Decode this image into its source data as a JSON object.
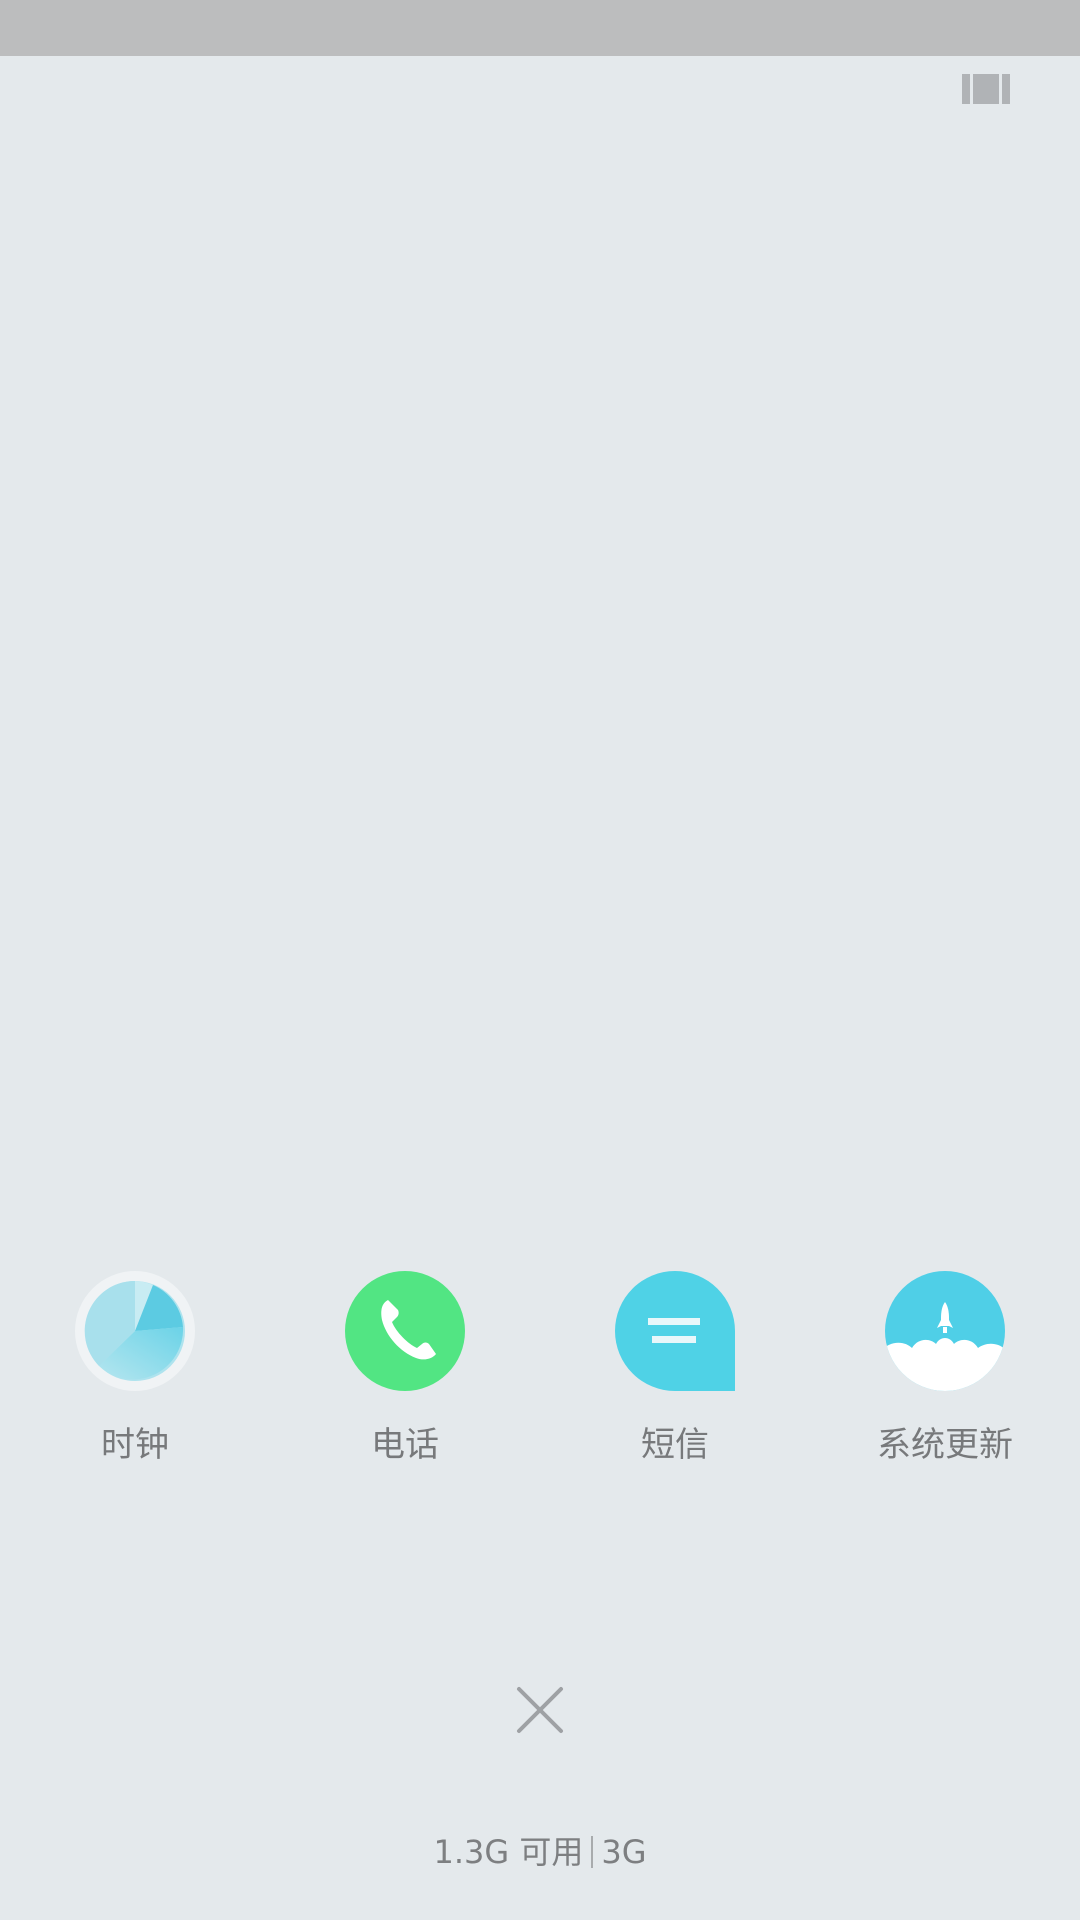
{
  "apps": [
    {
      "label": "时钟",
      "icon": "clock-icon",
      "color": "#5fd0e6"
    },
    {
      "label": "电话",
      "icon": "phone-icon",
      "color": "#52e583"
    },
    {
      "label": "短信",
      "icon": "message-icon",
      "color": "#4fd2e6"
    },
    {
      "label": "系统更新",
      "icon": "rocket-icon",
      "color": "#4fcfe7"
    }
  ],
  "memory": {
    "available": "1.3G 可用",
    "total": "3G"
  }
}
